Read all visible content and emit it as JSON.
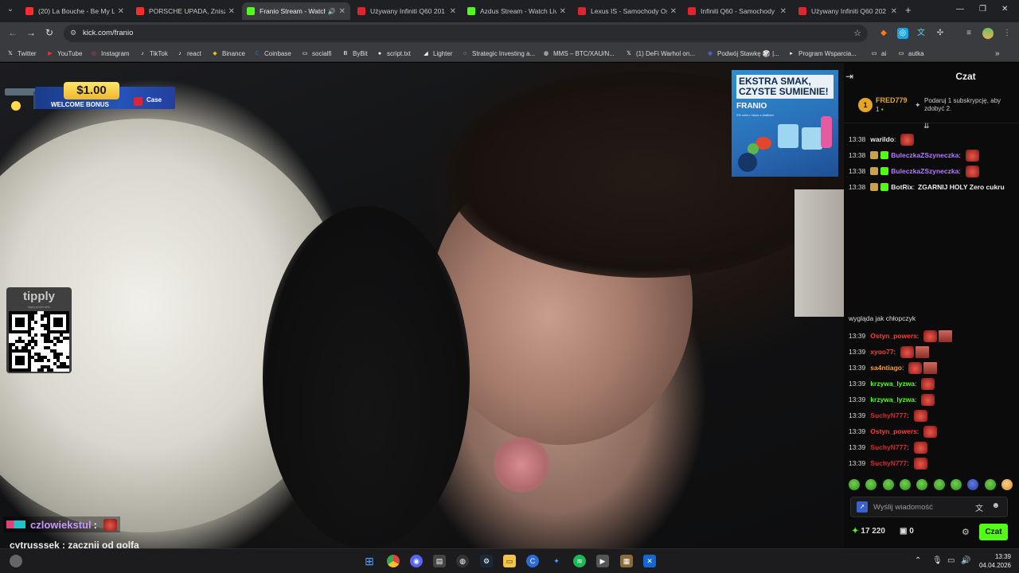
{
  "browser": {
    "tabs": [
      {
        "title": "(20) La Bouche - Be My Lo",
        "favicon": "youtube-icon",
        "color": "#ff2c2c"
      },
      {
        "title": "PORSCHE UPADA, Zniszcz",
        "favicon": "youtube-icon",
        "color": "#ff2c2c"
      },
      {
        "title": "Franio Stream - Watch",
        "favicon": "kick-icon",
        "color": "#53fc18",
        "active": true
      },
      {
        "title": "Używany Infiniti Q60 201",
        "favicon": "otomoto-icon",
        "color": "#e0252f"
      },
      {
        "title": "Azdus Stream - Watch Liv",
        "favicon": "kick-icon",
        "color": "#53fc18"
      },
      {
        "title": "Lexus IS - Samochody Os",
        "favicon": "otomoto-icon",
        "color": "#e0252f"
      },
      {
        "title": "Infiniti Q60 - Samochody",
        "favicon": "otomoto-icon",
        "color": "#e0252f"
      },
      {
        "title": "Używany Infiniti Q60 202",
        "favicon": "otomoto-icon",
        "color": "#e0252f"
      }
    ],
    "url": "kick.com/franio",
    "bookmarks": [
      {
        "label": "Twitter",
        "icon": "x-icon"
      },
      {
        "label": "YouTube",
        "icon": "youtube-icon"
      },
      {
        "label": "Instagram",
        "icon": "instagram-icon"
      },
      {
        "label": "TikTok",
        "icon": "tiktok-icon"
      },
      {
        "label": "react",
        "icon": "tiktok-icon"
      },
      {
        "label": "Binance",
        "icon": "binance-icon"
      },
      {
        "label": "Coinbase",
        "icon": "coinbase-icon"
      },
      {
        "label": "socialfi",
        "icon": "folder-icon"
      },
      {
        "label": "ByBit",
        "icon": "bybit-icon"
      },
      {
        "label": "script.txt",
        "icon": "github-icon"
      },
      {
        "label": "Lighter",
        "icon": "lighter-icon"
      },
      {
        "label": "Strategic Investing a...",
        "icon": "loading-icon"
      },
      {
        "label": "MMS – BTC/XAU/N...",
        "icon": "globe-icon"
      },
      {
        "label": "(1) DeFi Warhol on...",
        "icon": "x-icon"
      },
      {
        "label": "Podwój Stawkę 🎲 |...",
        "icon": "discord-icon"
      },
      {
        "label": "Program Wsparcia...",
        "icon": "bookmark-icon"
      },
      {
        "label": "ai",
        "icon": "folder-icon"
      },
      {
        "label": "autka",
        "icon": "folder-icon"
      }
    ]
  },
  "stream": {
    "bonus": {
      "amount": "$1.00",
      "text": "WELCOME BONUS",
      "brand": "Case"
    },
    "tipply": {
      "name": "tipply",
      "sub": "tipply.pl/@franio"
    },
    "ad": {
      "headline": "EKSTRA SMAK, CZYSTE SUMIENIE!",
      "brand": "FRANIO",
      "sub": "0% cukru i baza z białkiem"
    },
    "overlay_chat": [
      {
        "user": "czlowiekstul",
        "sep": ":"
      },
      {
        "text": "cytrusssek : zacznij od golfa"
      }
    ]
  },
  "chat": {
    "title": "Czat",
    "pinned": {
      "rank": "1",
      "user": "FRED779",
      "count": "1",
      "text": "Podaruj 1 subskrypcję, aby zdobyć 2."
    },
    "messages_top": [
      {
        "time": "13:38",
        "user": "warildo",
        "color": "#e8e8e8",
        "emotes": 1
      },
      {
        "time": "13:38",
        "user": "BuleczkaZSzyneczka",
        "color": "#b57aff",
        "emotes": 1
      },
      {
        "time": "13:38",
        "user": "BuleczkaZSzyneczka",
        "color": "#b57aff",
        "emotes": 1
      },
      {
        "time": "13:38",
        "user": "BotRix",
        "color": "#e8e8e8",
        "text": "ZGARNIJ HOLY Zero cukru"
      }
    ],
    "cam_caption": "wygląda jak chłopczyk",
    "messages": [
      {
        "time": "13:39",
        "user": "Ostyn_powers",
        "color": "#ff3b3b",
        "emotes": 2
      },
      {
        "time": "13:39",
        "user": "xyoo77",
        "color": "#ff3b3b",
        "emotes": 2
      },
      {
        "time": "13:39",
        "user": "sa4ntiago",
        "color": "#ff9a2e",
        "emotes": 2
      },
      {
        "time": "13:39",
        "user": "krzywa_lyzwa",
        "color": "#53fc18",
        "emotes": 1
      },
      {
        "time": "13:39",
        "user": "krzywa_lyzwa",
        "color": "#53fc18",
        "emotes": 1
      },
      {
        "time": "13:39",
        "user": "SuchyN777",
        "color": "#e0252f",
        "emotes": 1
      },
      {
        "time": "13:39",
        "user": "Ostyn_powers",
        "color": "#ff3b3b",
        "emotes": 1
      },
      {
        "time": "13:39",
        "user": "SuchyN777",
        "color": "#e0252f",
        "emotes": 1
      },
      {
        "time": "13:39",
        "user": "SuchyN777",
        "color": "#e0252f",
        "emotes": 1
      }
    ],
    "input_placeholder": "Wyślij wiadomość",
    "points": "17 220",
    "subs": "0",
    "send_label": "Czat"
  },
  "taskbar": {
    "time": "13:39",
    "date": "04.04.2026"
  }
}
